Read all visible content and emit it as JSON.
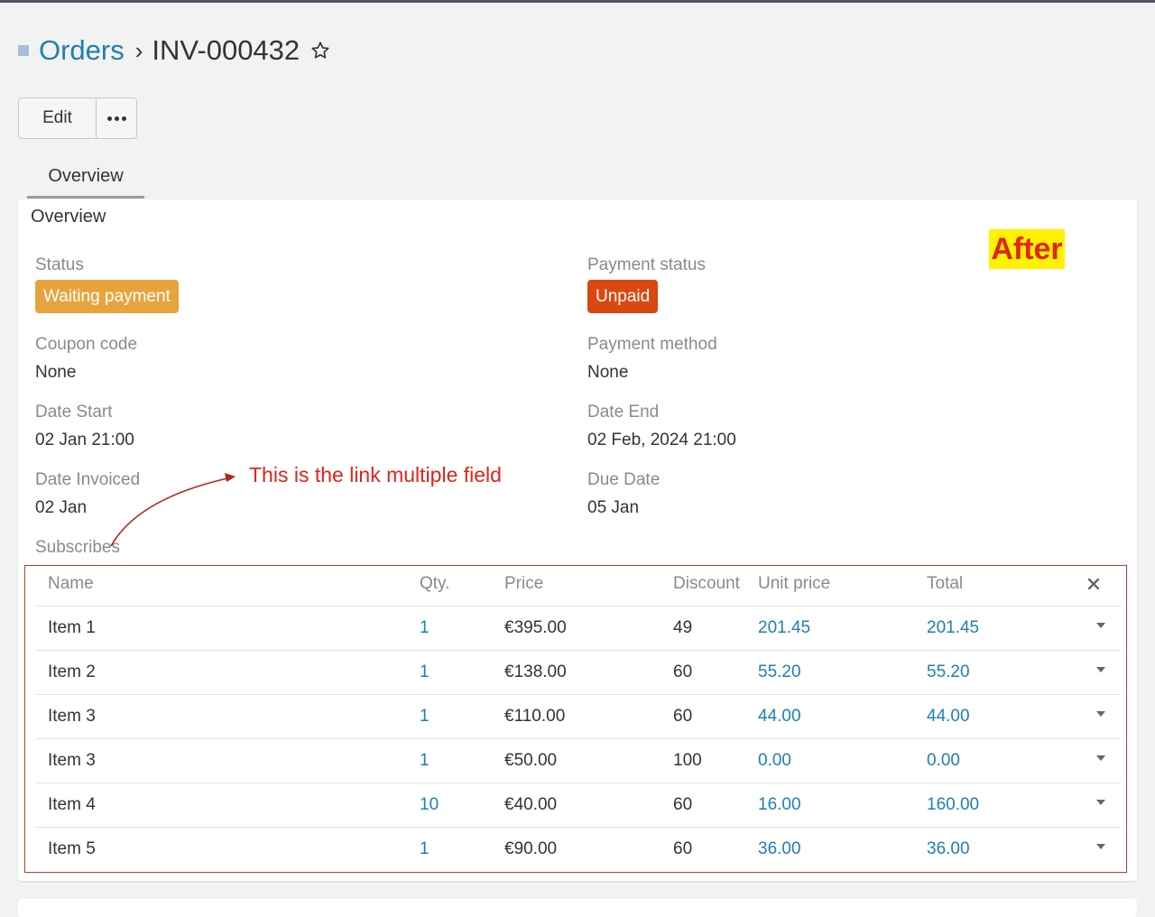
{
  "breadcrumb": {
    "parent": "Orders",
    "separator": "›",
    "current": "INV-000432"
  },
  "toolbar": {
    "edit_label": "Edit"
  },
  "tabs": [
    {
      "label": "Overview"
    }
  ],
  "panel": {
    "title": "Overview",
    "annotation_badge": "After",
    "annotation_note": "This is the link multiple field",
    "fields": {
      "status": {
        "label": "Status",
        "value": "Waiting payment"
      },
      "payment_status": {
        "label": "Payment status",
        "value": "Unpaid"
      },
      "coupon_code": {
        "label": "Coupon code",
        "value": "None"
      },
      "payment_method": {
        "label": "Payment method",
        "value": "None"
      },
      "date_start": {
        "label": "Date Start",
        "value": "02 Jan 21:00"
      },
      "date_end": {
        "label": "Date End",
        "value": "02 Feb, 2024 21:00"
      },
      "date_invoiced": {
        "label": "Date Invoiced",
        "value": "02 Jan"
      },
      "due_date": {
        "label": "Due Date",
        "value": "05 Jan"
      },
      "subscribes": {
        "label": "Subscribes"
      }
    }
  },
  "colors": {
    "link": "#1f7fae",
    "warning": "#e8a33d",
    "danger": "#d9480f",
    "annotation": "#e2231a",
    "highlight": "#fff200"
  },
  "table": {
    "headers": {
      "name": "Name",
      "qty": "Qty.",
      "price": "Price",
      "discount": "Discount",
      "unit_price": "Unit price",
      "total": "Total"
    },
    "rows": [
      {
        "name": "Item 1",
        "qty": "1",
        "price": "€395.00",
        "discount": "49",
        "unit_price": "201.45",
        "total": "201.45"
      },
      {
        "name": "Item 2",
        "qty": "1",
        "price": "€138.00",
        "discount": "60",
        "unit_price": "55.20",
        "total": "55.20"
      },
      {
        "name": "Item 3",
        "qty": "1",
        "price": "€110.00",
        "discount": "60",
        "unit_price": "44.00",
        "total": "44.00"
      },
      {
        "name": "Item 3",
        "qty": "1",
        "price": "€50.00",
        "discount": "100",
        "unit_price": "0.00",
        "total": "0.00"
      },
      {
        "name": "Item 4",
        "qty": "10",
        "price": "€40.00",
        "discount": "60",
        "unit_price": "16.00",
        "total": "160.00"
      },
      {
        "name": "Item 5",
        "qty": "1",
        "price": "€90.00",
        "discount": "60",
        "unit_price": "36.00",
        "total": "36.00"
      }
    ]
  }
}
